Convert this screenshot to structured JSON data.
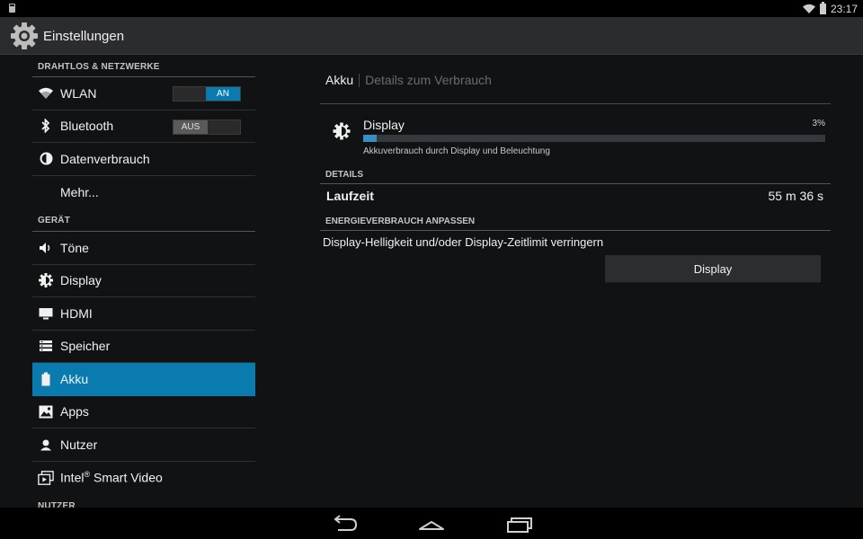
{
  "status_bar": {
    "time": "23:17",
    "icons": [
      "sd-card-icon",
      "wifi-icon",
      "battery-icon"
    ]
  },
  "action_bar": {
    "title": "Einstellungen",
    "icon": "gear-icon"
  },
  "sidebar": {
    "sections": [
      {
        "header": "DRAHTLOS & NETZWERKE",
        "items": [
          {
            "label": "WLAN",
            "icon": "wifi-icon",
            "toggle": "AN"
          },
          {
            "label": "Bluetooth",
            "icon": "bluetooth-icon",
            "toggle": "AUS"
          },
          {
            "label": "Datenverbrauch",
            "icon": "data-usage-icon"
          },
          {
            "label": "Mehr..."
          }
        ]
      },
      {
        "header": "GERÄT",
        "items": [
          {
            "label": "Töne",
            "icon": "speaker-icon"
          },
          {
            "label": "Display",
            "icon": "brightness-icon"
          },
          {
            "label": "HDMI",
            "icon": "monitor-icon"
          },
          {
            "label": "Speicher",
            "icon": "storage-icon"
          },
          {
            "label": "Akku",
            "icon": "battery-icon",
            "active": true
          },
          {
            "label": "Apps",
            "icon": "apps-icon"
          },
          {
            "label": "Nutzer",
            "icon": "user-icon"
          },
          {
            "label": "Intel",
            "label_sup": "®",
            "label_suffix": " Smart Video",
            "icon": "smart-video-icon"
          }
        ]
      },
      {
        "header": "NUTZER",
        "items": []
      }
    ]
  },
  "content": {
    "breadcrumb": {
      "active": "Akku",
      "inactive": "Details zum Verbrauch"
    },
    "usage": {
      "name": "Display",
      "percent_label": "3%",
      "percent": 3,
      "description": "Akkuverbrauch durch Display und Beleuchtung",
      "icon": "brightness-icon"
    },
    "details_header": "DETAILS",
    "runtime": {
      "label": "Laufzeit",
      "value": "55 m 36 s"
    },
    "adjust_header": "ENERGIEVERBRAUCH ANPASSEN",
    "adjust_text": "Display-Helligkeit und/oder Display-Zeitlimit verringern",
    "adjust_button": "Display"
  },
  "colors": {
    "accent": "#0a7bae",
    "progress": "#3b8ec2",
    "background": "#101214",
    "action_bar": "#2b2c2e"
  },
  "nav_bar": {
    "buttons": [
      "back-icon",
      "home-icon",
      "recents-icon"
    ]
  }
}
